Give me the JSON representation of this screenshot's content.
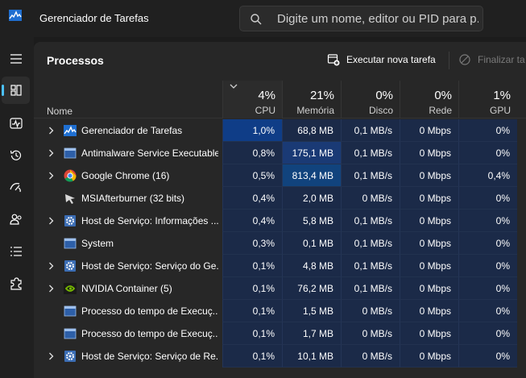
{
  "app": {
    "title": "Gerenciador de Tarefas"
  },
  "search": {
    "placeholder": "Digite um nome, editor ou PID para p..."
  },
  "sidebar": {
    "items": [
      "menu",
      "processos",
      "desempenho",
      "historico",
      "inicializacao",
      "usuarios",
      "detalhes",
      "servicos"
    ]
  },
  "page": {
    "title": "Processos"
  },
  "toolbar": {
    "run_task": "Executar nova tarefa",
    "end_task": "Finalizar ta"
  },
  "columns": {
    "name": "Nome",
    "cpu": {
      "pct": "4%",
      "label": "CPU"
    },
    "memory": {
      "pct": "21%",
      "label": "Memória"
    },
    "disk": {
      "pct": "0%",
      "label": "Disco"
    },
    "network": {
      "pct": "0%",
      "label": "Rede"
    },
    "gpu": {
      "pct": "1%",
      "label": "GPU"
    }
  },
  "processes": [
    {
      "name": "Gerenciador de Tarefas",
      "icon": "taskmgr-icon",
      "expandable": true,
      "cpu": "1,0%",
      "memory": "68,8 MB",
      "disk": "0,1 MB/s",
      "network": "0 Mbps",
      "gpu": "0%"
    },
    {
      "name": "Antimalware Service Executable",
      "icon": "service-window-icon",
      "expandable": true,
      "cpu": "0,8%",
      "memory": "175,1 MB",
      "disk": "0,1 MB/s",
      "network": "0 Mbps",
      "gpu": "0%"
    },
    {
      "name": "Google Chrome (16)",
      "icon": "chrome-icon",
      "expandable": true,
      "cpu": "0,5%",
      "memory": "813,4 MB",
      "disk": "0,1 MB/s",
      "network": "0 Mbps",
      "gpu": "0,4%"
    },
    {
      "name": "MSIAfterburner (32 bits)",
      "icon": "afterburner-icon",
      "expandable": false,
      "cpu": "0,4%",
      "memory": "2,0 MB",
      "disk": "0 MB/s",
      "network": "0 Mbps",
      "gpu": "0%"
    },
    {
      "name": "Host de Serviço: Informações ...",
      "icon": "gear-icon",
      "expandable": true,
      "cpu": "0,4%",
      "memory": "5,8 MB",
      "disk": "0,1 MB/s",
      "network": "0 Mbps",
      "gpu": "0%"
    },
    {
      "name": "System",
      "icon": "system-window-icon",
      "expandable": false,
      "cpu": "0,3%",
      "memory": "0,1 MB",
      "disk": "0,1 MB/s",
      "network": "0 Mbps",
      "gpu": "0%"
    },
    {
      "name": "Host de Serviço: Serviço do Ge...",
      "icon": "gear-icon",
      "expandable": true,
      "cpu": "0,1%",
      "memory": "4,8 MB",
      "disk": "0,1 MB/s",
      "network": "0 Mbps",
      "gpu": "0%"
    },
    {
      "name": "NVIDIA Container (5)",
      "icon": "nvidia-icon",
      "expandable": true,
      "cpu": "0,1%",
      "memory": "76,2 MB",
      "disk": "0,1 MB/s",
      "network": "0 Mbps",
      "gpu": "0%"
    },
    {
      "name": "Processo do tempo de Execuç...",
      "icon": "system-window-icon",
      "expandable": false,
      "cpu": "0,1%",
      "memory": "1,5 MB",
      "disk": "0 MB/s",
      "network": "0 Mbps",
      "gpu": "0%"
    },
    {
      "name": "Processo do tempo de Execuç...",
      "icon": "system-window-icon",
      "expandable": false,
      "cpu": "0,1%",
      "memory": "1,7 MB",
      "disk": "0 MB/s",
      "network": "0 Mbps",
      "gpu": "0%"
    },
    {
      "name": "Host de Serviço: Serviço de Re...",
      "icon": "gear-icon",
      "expandable": true,
      "cpu": "0,1%",
      "memory": "10,1 MB",
      "disk": "0 MB/s",
      "network": "0 Mbps",
      "gpu": "0%"
    }
  ],
  "colors": {
    "accent": "#4cc2ff",
    "cell": "#1b2a48",
    "hot_cell": "#0f3d87"
  }
}
